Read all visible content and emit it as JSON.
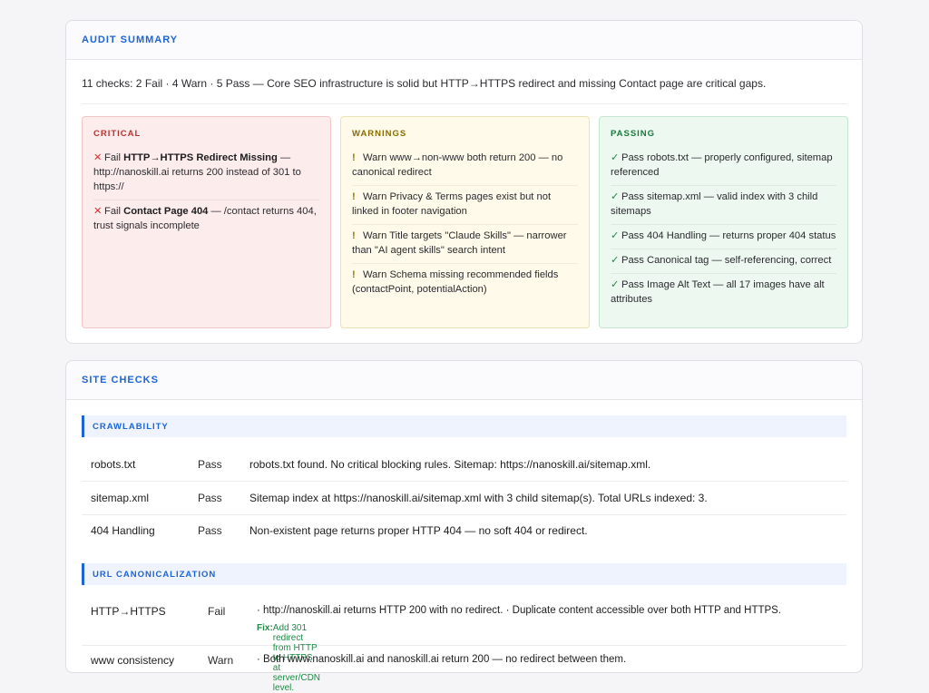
{
  "summary": {
    "title": "AUDIT SUMMARY",
    "text": "11 checks: 2 Fail · 4 Warn · 5 Pass — Core SEO infrastructure is solid but HTTP→HTTPS redirect and missing Contact page are critical gaps.",
    "critical": {
      "title": "CRITICAL",
      "items": [
        {
          "status": "Fail",
          "name": "HTTP→HTTPS Redirect Missing",
          "detail": " — http://nanoskill.ai returns 200 instead of 301 to https://"
        },
        {
          "status": "Fail",
          "name": "Contact Page 404",
          "detail": " — /contact returns 404, trust signals incomplete"
        }
      ]
    },
    "warnings": {
      "title": "WARNINGS",
      "items": [
        {
          "status": "Warn",
          "text": "www→non-www both return 200 — no canonical redirect"
        },
        {
          "status": "Warn",
          "text": "Privacy & Terms pages exist but not linked in footer navigation"
        },
        {
          "status": "Warn",
          "text": "Title targets \"Claude Skills\" — narrower than \"AI agent skills\" search intent"
        },
        {
          "status": "Warn",
          "text": "Schema missing recommended fields (contactPoint, potentialAction)"
        }
      ]
    },
    "passing": {
      "title": "PASSING",
      "items": [
        {
          "status": "Pass",
          "text": "robots.txt — properly configured, sitemap referenced"
        },
        {
          "status": "Pass",
          "text": "sitemap.xml — valid index with 3 child sitemaps"
        },
        {
          "status": "Pass",
          "text": "404 Handling — returns proper 404 status"
        },
        {
          "status": "Pass",
          "text": "Canonical tag — self-referencing, correct"
        },
        {
          "status": "Pass",
          "text": "Image Alt Text — all 17 images have alt attributes"
        }
      ]
    }
  },
  "checks": {
    "title": "SITE CHECKS",
    "crawlability": {
      "title": "CRAWLABILITY",
      "rows": [
        {
          "name": "robots.txt",
          "status": "Pass",
          "desc": "robots.txt found. No critical blocking rules. Sitemap: https://nanoskill.ai/sitemap.xml."
        },
        {
          "name": "sitemap.xml",
          "status": "Pass",
          "desc": "Sitemap index at https://nanoskill.ai/sitemap.xml with 3 child sitemap(s). Total URLs indexed: 3."
        },
        {
          "name": "404 Handling",
          "status": "Pass",
          "desc": "Non-existent page returns proper HTTP 404 — no soft 404 or redirect."
        }
      ]
    },
    "canonicalization": {
      "title": "URL CANONICALIZATION",
      "rows": [
        {
          "name": "HTTP→HTTPS",
          "status": "Fail",
          "desc": "· http://nanoskill.ai returns HTTP 200 with no redirect. · Duplicate content accessible over both HTTP and HTTPS.",
          "fix_label": "Fix:",
          "fix": " Add 301 redirect from HTTP to HTTPS at server/CDN level."
        },
        {
          "name": "www consistency",
          "status": "Warn",
          "desc": "· Both www.nanoskill.ai and nanoskill.ai return 200 — no redirect between them."
        }
      ]
    }
  }
}
